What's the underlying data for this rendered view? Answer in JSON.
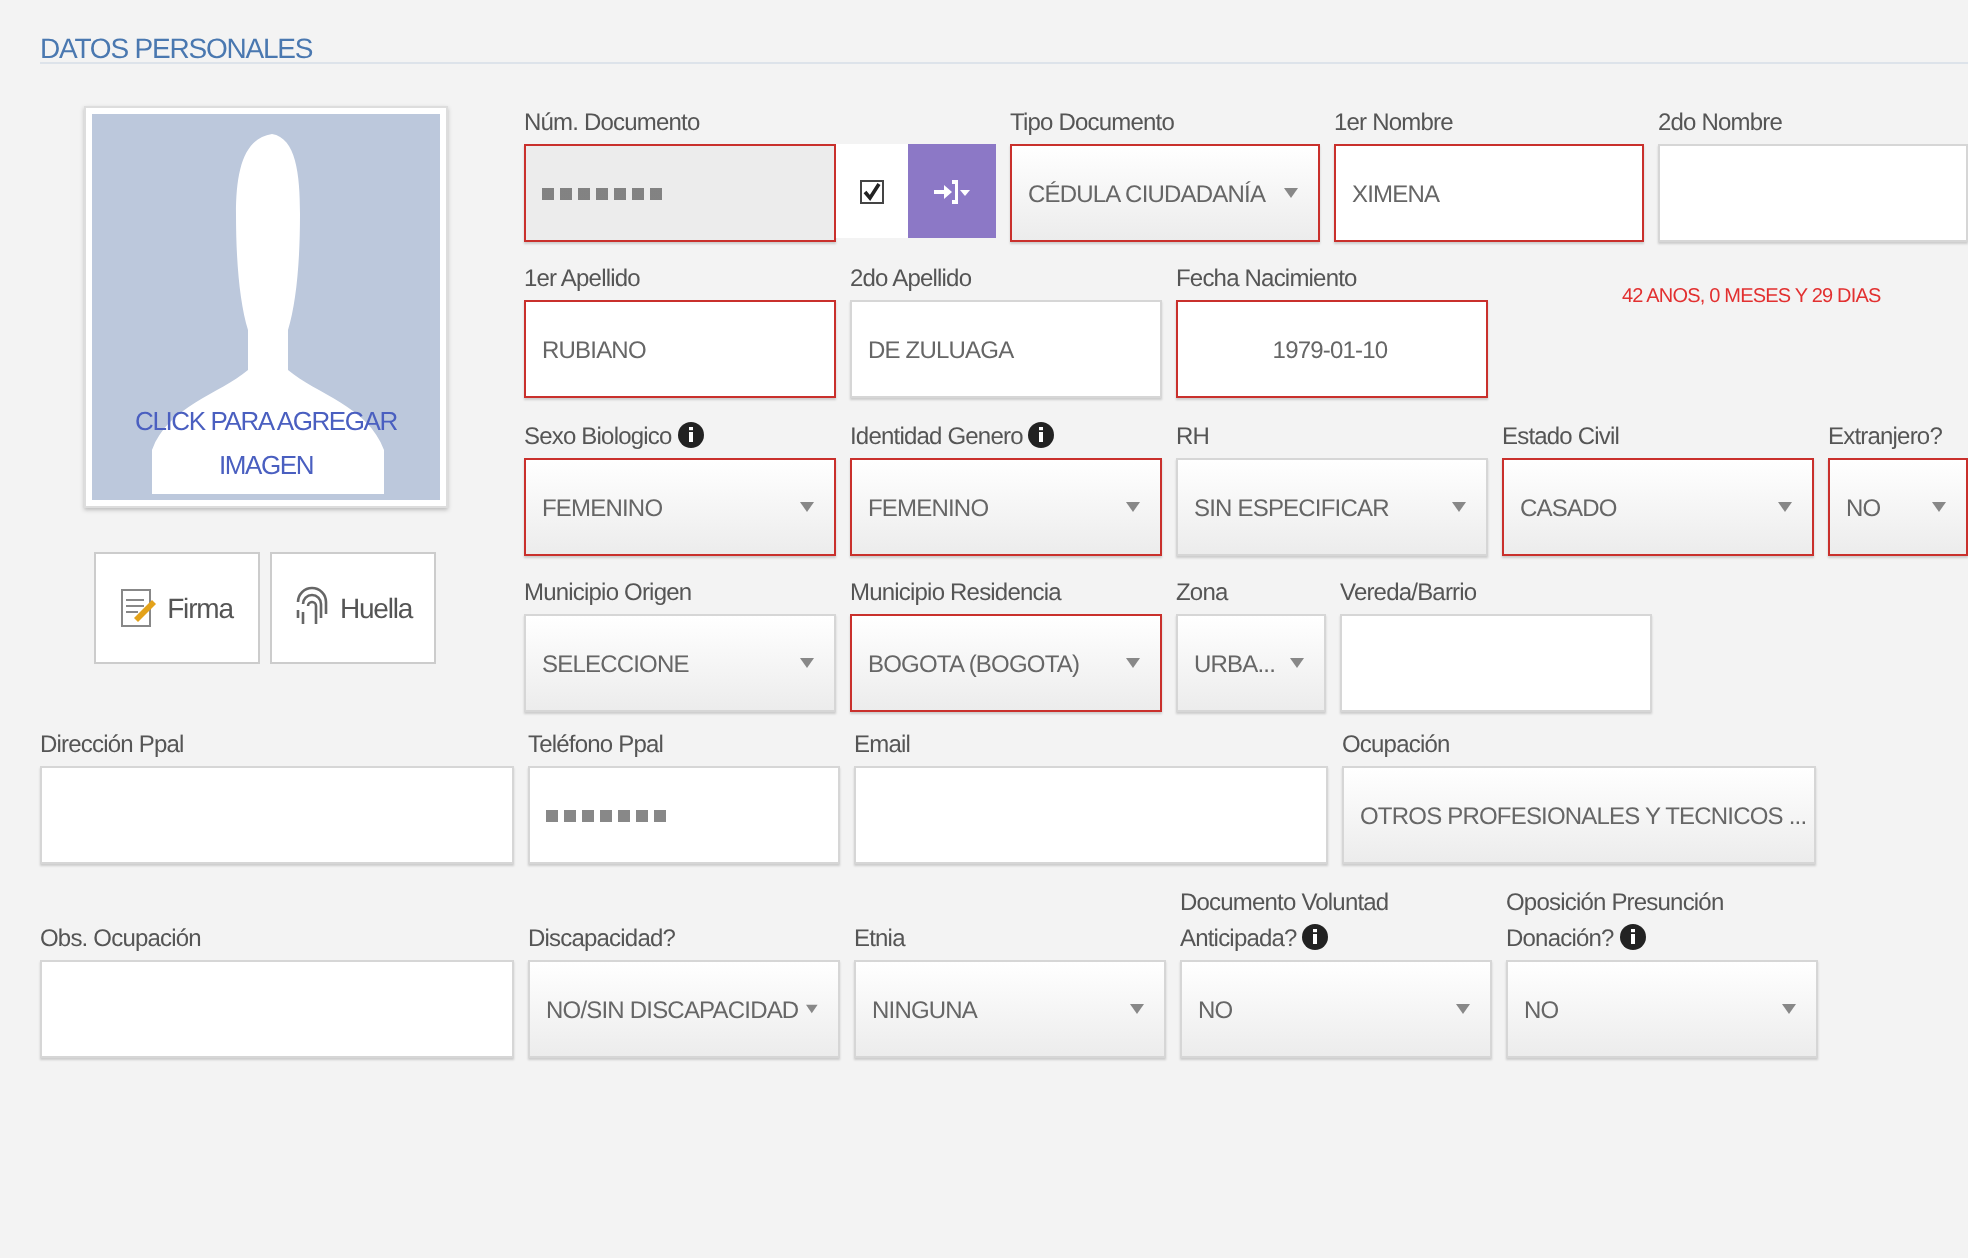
{
  "section_title": "DATOS PERSONALES",
  "photo": {
    "caption": "CLICK PARA AGREGAR IMAGEN"
  },
  "photo_buttons": [
    {
      "kind": "signature",
      "label": "Firma"
    },
    {
      "kind": "fingerprint",
      "label": "Huella"
    }
  ],
  "rows": [
    [
      {
        "kind": "doc",
        "label": "Núm. Documento",
        "required": true,
        "checked": true,
        "redacted": true
      },
      {
        "kind": "select",
        "label": "Tipo Documento",
        "value": "CÉDULA CIUDADANÍA",
        "required": true
      },
      {
        "kind": "text",
        "label": "1er Nombre",
        "value": "XIMENA",
        "required": true
      },
      {
        "kind": "text",
        "label": "2do Nombre",
        "required": false
      }
    ],
    [
      {
        "kind": "text",
        "label": "1er Apellido",
        "value": "RUBIANO",
        "required": true
      },
      {
        "kind": "text",
        "label": "2do Apellido",
        "value": "DE ZULUAGA",
        "required": false
      },
      {
        "kind": "date",
        "label": "Fecha Nacimiento",
        "value": "1979-01-10",
        "required": true
      },
      {
        "kind": "note",
        "value": "42 ANOS, 0 MESES Y 29 DIAS"
      }
    ],
    [
      {
        "kind": "select",
        "label": "Sexo Biologico",
        "info": true,
        "value": "FEMENINO",
        "required": true
      },
      {
        "kind": "select",
        "label": "Identidad Genero",
        "info": true,
        "value": "FEMENINO",
        "required": true
      },
      {
        "kind": "select",
        "label": "RH",
        "value": "SIN ESPECIFICAR",
        "required": false
      },
      {
        "kind": "select",
        "label": "Estado Civil",
        "value": "CASADO",
        "required": true
      },
      {
        "kind": "select",
        "label": "Extranjero?",
        "value": "NO",
        "required": true
      }
    ],
    [
      {
        "kind": "select",
        "label": "Municipio Origen",
        "value": "SELECCIONE",
        "required": false
      },
      {
        "kind": "select",
        "label": "Municipio Residencia",
        "value": "BOGOTA (BOGOTA)",
        "required": true
      },
      {
        "kind": "select",
        "label": "Zona",
        "value": "URBA...",
        "required": false
      },
      {
        "kind": "text",
        "label": "Vereda/Barrio",
        "required": false
      }
    ],
    [
      {
        "kind": "text",
        "label": "Dirección Ppal",
        "required": false
      },
      {
        "kind": "text",
        "label": "Teléfono Ppal",
        "required": false,
        "redacted": true
      },
      {
        "kind": "text",
        "label": "Email",
        "required": false
      },
      {
        "kind": "select",
        "label": "Ocupación",
        "value": "OTROS PROFESIONALES Y TECNICOS ...",
        "required": false
      }
    ],
    [
      {
        "kind": "text",
        "label": "Obs. Ocupación",
        "required": false
      },
      {
        "kind": "select",
        "label": "Discapacidad?",
        "value": "NO/SIN DISCAPACIDAD",
        "required": false
      },
      {
        "kind": "select",
        "label": "Etnia",
        "value": "NINGUNA",
        "required": false
      },
      {
        "kind": "select",
        "label": "Documento Voluntad Anticipada?",
        "info": true,
        "value": "NO",
        "required": false
      },
      {
        "kind": "select",
        "label": "Oposición Presunción Donación?",
        "info": true,
        "value": "NO",
        "required": false
      }
    ]
  ]
}
